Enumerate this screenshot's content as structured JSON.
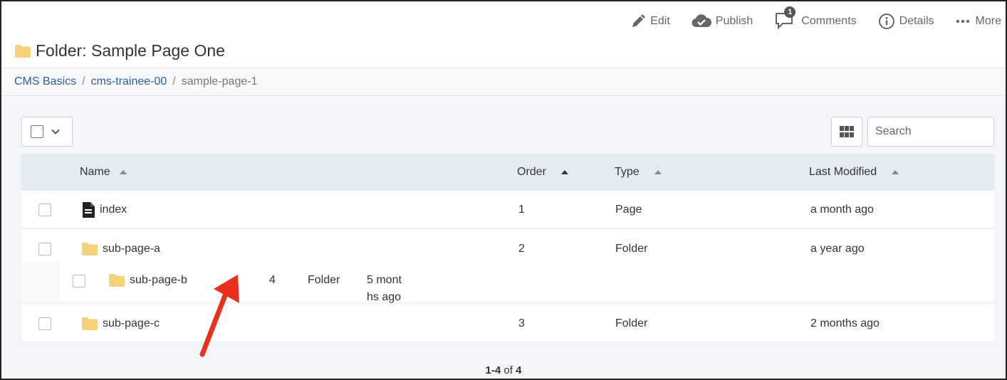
{
  "toolbar": {
    "edit": "Edit",
    "publish": "Publish",
    "comments": "Comments",
    "comments_count": "1",
    "details": "Details",
    "more": "More"
  },
  "title": "Folder: Sample Page One",
  "breadcrumb": {
    "items": [
      "CMS Basics",
      "cms-trainee-00"
    ],
    "current": "sample-page-1",
    "separator": "/"
  },
  "search": {
    "placeholder": "Search"
  },
  "table": {
    "columns": [
      "Name",
      "Order",
      "Type",
      "Last Modified"
    ],
    "rows": [
      {
        "name": "index",
        "icon": "page-icon",
        "order": "1",
        "type": "Page",
        "modified": "a month ago"
      },
      {
        "name": "sub-page-a",
        "icon": "folder-icon",
        "order": "2",
        "type": "Folder",
        "modified": "a year ago"
      },
      {
        "name": "sub-page-c",
        "icon": "folder-icon",
        "order": "3",
        "type": "Folder",
        "modified": "2 months ago"
      }
    ],
    "dragged_row": {
      "name": "sub-page-b",
      "icon": "folder-icon",
      "order": "4",
      "type": "Folder",
      "modified_line1": "5 mont",
      "modified_line2": "hs ago"
    }
  },
  "pager": {
    "range": "1-4",
    "of": "of",
    "total": "4"
  },
  "colors": {
    "link": "#2e6199",
    "folder": "#f5d27a",
    "header_bg": "#e4ebf2",
    "arrow": "#e8301c"
  }
}
